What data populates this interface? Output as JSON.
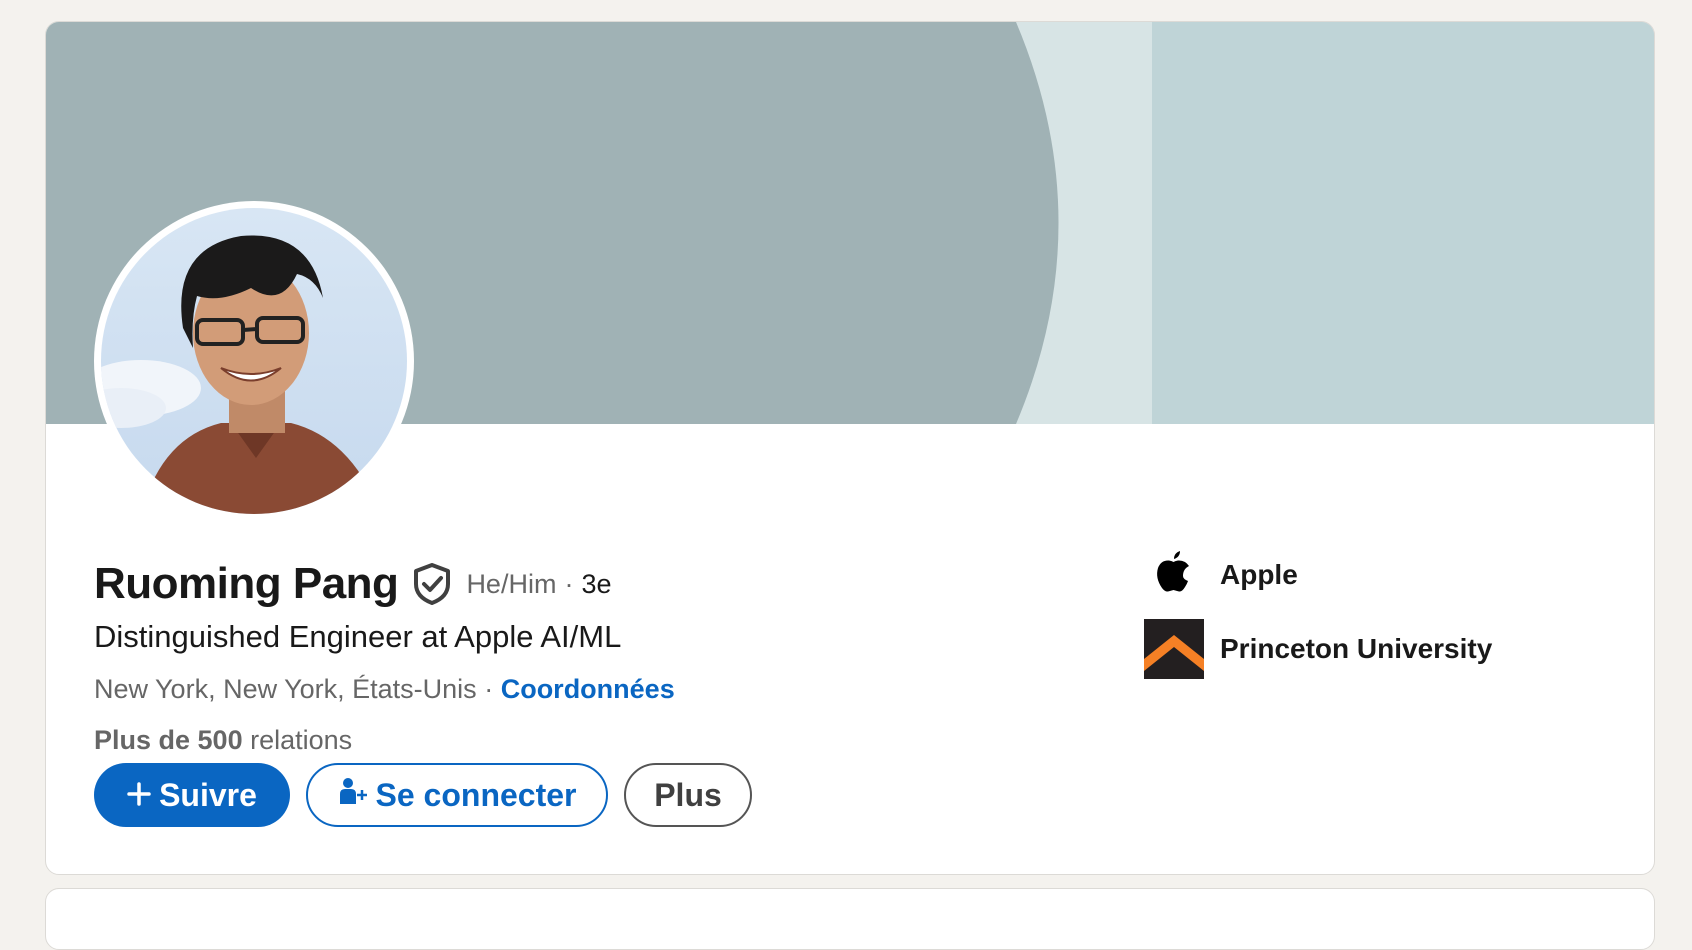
{
  "profile": {
    "name": "Ruoming Pang",
    "pronouns": "He/Him",
    "separator": "·",
    "degree": "3e",
    "headline": "Distinguished Engineer at Apple AI/ML",
    "location": "New York, New York, États-Unis",
    "contact_link": "Coordonnées",
    "connections_bold": "Plus de 500",
    "connections_rest": " relations"
  },
  "actions": {
    "follow_label": "Suivre",
    "connect_label": "Se connecter",
    "more_label": "Plus"
  },
  "sidebar": {
    "items": [
      {
        "label": "Apple",
        "icon": "apple-logo-icon"
      },
      {
        "label": "Princeton University",
        "icon": "princeton-logo-icon"
      }
    ]
  },
  "colors": {
    "accent": "#0a66c2",
    "banner_dark": "#a0b2b5",
    "banner_light": "#bfd4d7",
    "princeton_orange": "#f58025"
  }
}
